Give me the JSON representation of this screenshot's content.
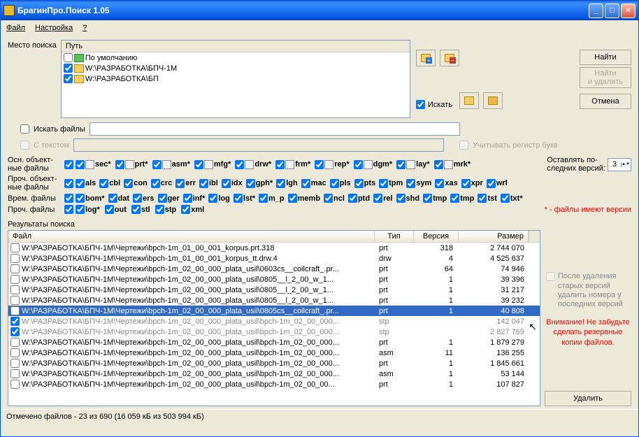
{
  "title": "БрагинПро.Поиск 1.05",
  "menu": {
    "file": "Файл",
    "settings": "Настройка",
    "help": "?"
  },
  "labels": {
    "place": "Место поиска",
    "pathHeader": "Путь",
    "searchFiles": "Искать файлы",
    "withText": "С текстом",
    "searchChk": "Искать",
    "caseSens": "Учитывать регистр букв",
    "mainObj": "Осн. объект-\nные файлы",
    "otherObj": "Проч. объект-\nные файлы",
    "tempFiles": "Врем. файлы",
    "otherFiles": "Проч. файлы",
    "keepLast": "Оставлять по-\nследних версий:",
    "keepLastVal": "3",
    "versionsNote": "* - файлы имеют версии",
    "results": "Результаты поиска",
    "colFile": "Файл",
    "colType": "Тип",
    "colVer": "Версия",
    "colSize": "Размер",
    "sideOpt": "После удаления старых версий удалить номера у последних версий",
    "warning": "Внимание! Не забудьте сделать резервные копии файлов.",
    "status": "Отмечено файлов - 23 из 690  (16 059 кБ из 503 994 кБ)"
  },
  "buttons": {
    "find": "Найти",
    "findDelete": "Найти\nи удалить",
    "cancel": "Отмена",
    "delete": "Удалить"
  },
  "paths": [
    {
      "checked": false,
      "icon": "green",
      "text": "По умолчанию"
    },
    {
      "checked": true,
      "icon": "yellow",
      "text": "W:\\РАЗРАБОТКА\\БПЧ-1М"
    },
    {
      "checked": true,
      "icon": "yellow",
      "text": "W:\\РАЗРАБОТКА\\БП"
    }
  ],
  "exts1": [
    "sec*",
    "prt*",
    "asm*",
    "mfg*",
    "drw*",
    "frm*",
    "rep*",
    "dgm*",
    "lay*",
    "mrk*"
  ],
  "exts2": [
    "als",
    "cbl",
    "con",
    "crc",
    "err",
    "ibl",
    "idx",
    "gph*",
    "lgh",
    "mac",
    "pls",
    "pts",
    "tpm",
    "sym",
    "xas",
    "xpr",
    "wrl"
  ],
  "exts3": [
    "bom*",
    "dat",
    "ers",
    "ger",
    "inf*",
    "log",
    "lst*",
    "m_p",
    "memb",
    "ncl",
    "ptd",
    "rel",
    "shd",
    "tmp",
    "tmp",
    "tst",
    "txt*"
  ],
  "exts4": [
    "log*",
    "out",
    "stl",
    "stp",
    "xml"
  ],
  "rows": [
    {
      "chk": false,
      "file": "W:\\РАЗРАБОТКА\\БПЧ-1М\\Чертежи\\bpch-1m_01_00_001_korpus.prt.318",
      "typ": "prt",
      "ver": "318",
      "siz": "2 744 070"
    },
    {
      "chk": false,
      "file": "W:\\РАЗРАБОТКА\\БПЧ-1М\\Чертежи\\bpch-1m_01_00_001_korpus_tt.drw.4",
      "typ": "drw",
      "ver": "4",
      "siz": "4 525 637"
    },
    {
      "chk": false,
      "file": "W:\\РАЗРАБОТКА\\БПЧ-1М\\Чертежи\\bpch-1m_02_00_000_plata_usil\\0603cs__coilcraft_.pr...",
      "typ": "prt",
      "ver": "64",
      "siz": "74 946"
    },
    {
      "chk": false,
      "file": "W:\\РАЗРАБОТКА\\БПЧ-1М\\Чертежи\\bpch-1m_02_00_000_plata_usil\\0805__l_2_00_w_1...",
      "typ": "prt",
      "ver": "1",
      "siz": "39 396"
    },
    {
      "chk": false,
      "file": "W:\\РАЗРАБОТКА\\БПЧ-1М\\Чертежи\\bpch-1m_02_00_000_plata_usil\\0805__l_2_00_w_1...",
      "typ": "prt",
      "ver": "1",
      "siz": "31 217"
    },
    {
      "chk": false,
      "file": "W:\\РАЗРАБОТКА\\БПЧ-1М\\Чертежи\\bpch-1m_02_00_000_plata_usil\\0805__l_2_00_w_1...",
      "typ": "prt",
      "ver": "1",
      "siz": "39 232"
    },
    {
      "chk": false,
      "sel": true,
      "file": "W:\\РАЗРАБОТКА\\БПЧ-1М\\Чертежи\\bpch-1m_02_00_000_plata_usil\\0805cs__coilcraft_.pr...",
      "typ": "prt",
      "ver": "1",
      "siz": "40 808"
    },
    {
      "chk": true,
      "grey": true,
      "file": "W:\\РАЗРАБОТКА\\БПЧ-1М\\Чертежи\\bpch-1m_02_00_000_plata_usil\\bpch-1m_02_00_000...",
      "typ": "stp",
      "ver": "",
      "siz": "142 047"
    },
    {
      "chk": true,
      "grey": true,
      "file": "W:\\РАЗРАБОТКА\\БПЧ-1М\\Чертежи\\bpch-1m_02_00_000_plata_usil\\bpch-1m_02_00_000...",
      "typ": "stp",
      "ver": "",
      "siz": "2 827 769"
    },
    {
      "chk": false,
      "file": "W:\\РАЗРАБОТКА\\БПЧ-1М\\Чертежи\\bpch-1m_02_00_000_plata_usil\\bpch-1m_02_00_000...",
      "typ": "prt",
      "ver": "1",
      "siz": "1 879 279"
    },
    {
      "chk": false,
      "file": "W:\\РАЗРАБОТКА\\БПЧ-1М\\Чертежи\\bpch-1m_02_00_000_plata_usil\\bpch-1m_02_00_000...",
      "typ": "asm",
      "ver": "11",
      "siz": "136 255"
    },
    {
      "chk": false,
      "file": "W:\\РАЗРАБОТКА\\БПЧ-1М\\Чертежи\\bpch-1m_02_00_000_plata_usil\\bpch-1m_02_00_000...",
      "typ": "prt",
      "ver": "1",
      "siz": "1 845 661"
    },
    {
      "chk": false,
      "file": "W:\\РАЗРАБОТКА\\БПЧ-1М\\Чертежи\\bpch-1m_02_00_000_plata_usil\\bpch-1m_02_00_000...",
      "typ": "asm",
      "ver": "1",
      "siz": "53 144"
    },
    {
      "chk": false,
      "file": "W:\\РАЗРАБОТКА\\БПЧ-1М\\Чертежи\\bpch-1m_02_00_000_plata_usil\\bpch-1m_02_00_00...",
      "typ": "prt",
      "ver": "1",
      "siz": "107 827"
    }
  ]
}
